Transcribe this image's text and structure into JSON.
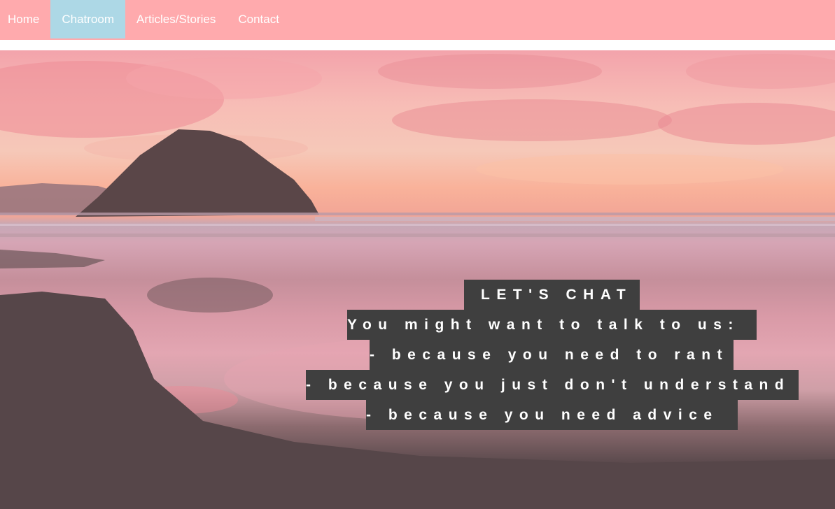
{
  "nav": {
    "items": [
      {
        "label": "Home"
      },
      {
        "label": "Chatroom"
      },
      {
        "label": "Articles/Stories"
      },
      {
        "label": "Contact"
      }
    ],
    "active": "Chatroom",
    "colors": {
      "bar": "#ffaaad",
      "active": "#add8e6",
      "text": "#ffffff"
    }
  },
  "hero": {
    "image": "beach-sunset-rock",
    "heading": "LET'S CHAT",
    "intro": "You might want to talk to us:",
    "reasons": [
      "- because you need to rant",
      "- because you just don't understand",
      "- because you need advice"
    ],
    "colors": {
      "text_bg": "#3f3f3f",
      "text": "#ffffff"
    }
  }
}
